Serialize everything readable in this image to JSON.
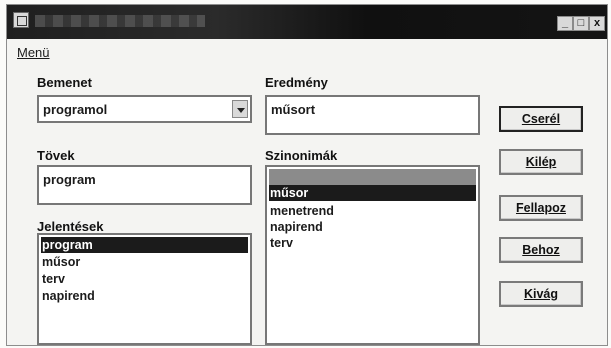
{
  "window": {
    "menu": "Menü",
    "controls": {
      "minimize": "_",
      "maximize": "□",
      "close": "x"
    }
  },
  "bemenet": {
    "label": "Bemenet",
    "value": "programol"
  },
  "eredmeny": {
    "label": "Eredmény",
    "value": "műsort"
  },
  "tovek": {
    "label": "Tövek",
    "value": "program"
  },
  "szinonimak": {
    "label": "Szinonimák",
    "items": [
      "",
      "műsor",
      "menetrend",
      "napirend",
      "terv"
    ]
  },
  "jelentesek": {
    "label": "Jelentések",
    "items": [
      "program",
      "műsor",
      "terv",
      "napirend"
    ]
  },
  "buttons": {
    "csere": "Cserél",
    "kilep": "Kilép",
    "fellapoz": "Fellapoz",
    "behoz": "Behoz",
    "kivag": "Kivág"
  },
  "colors": {
    "title_bar": "#1f1f1f",
    "selection": "#1b1b1b"
  }
}
